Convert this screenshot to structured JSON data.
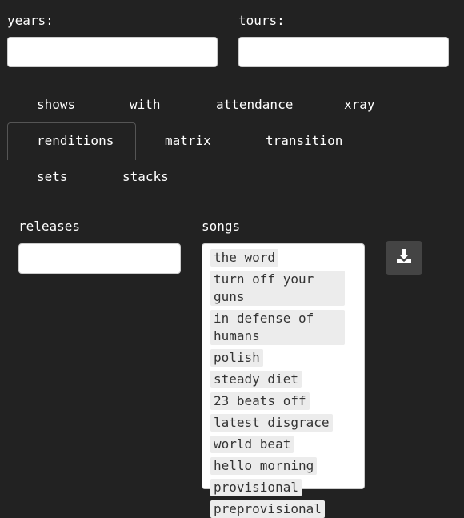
{
  "filters": {
    "years_label": "years:",
    "years_value": "",
    "tours_label": "tours:",
    "tours_value": ""
  },
  "tabs": [
    {
      "label": "shows"
    },
    {
      "label": "with"
    },
    {
      "label": "attendance"
    },
    {
      "label": "xray"
    },
    {
      "label": "renditions",
      "active": true
    },
    {
      "label": "matrix"
    },
    {
      "label": "transition"
    },
    {
      "label": "sets"
    },
    {
      "label": "stacks"
    }
  ],
  "renditions": {
    "releases_label": "releases",
    "releases_value": "",
    "songs_label": "songs",
    "songs": [
      "the word",
      "turn off your guns",
      "in defense of humans",
      "polish",
      "steady diet",
      "23 beats off",
      "latest disgrace",
      "world beat",
      "hello morning",
      "provisional",
      "preprovisional"
    ],
    "download_icon": "download-icon"
  },
  "colors": {
    "background": "#222222",
    "chip_background": "#ececec",
    "button_background": "#444444"
  }
}
